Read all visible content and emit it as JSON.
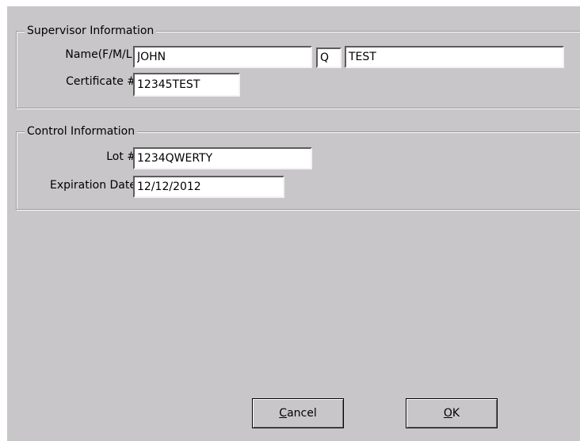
{
  "supervisor": {
    "title": "Supervisor Information",
    "name_label": "Name(F/M/L)",
    "first_name": "JOHN",
    "middle_initial": "Q",
    "last_name": "TEST",
    "certificate_label": "Certificate #",
    "certificate": "12345TEST"
  },
  "control": {
    "title": "Control Information",
    "lot_label": "Lot #",
    "lot": "1234QWERTY",
    "expiration_label": "Expiration Date",
    "expiration": "12/12/2012"
  },
  "buttons": {
    "cancel_label": "Cancel",
    "ok_label": "OK"
  }
}
